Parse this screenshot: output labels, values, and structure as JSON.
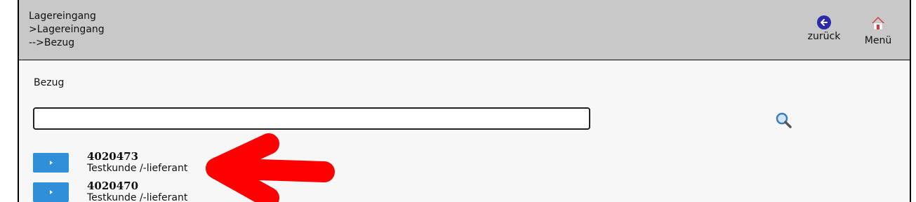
{
  "header": {
    "breadcrumbs": [
      "Lagereingang",
      ">Lagereingang",
      "-->Bezug"
    ],
    "back_label": "zurück",
    "menu_label": "Menü"
  },
  "main": {
    "section_title": "Bezug",
    "search": {
      "value": "",
      "placeholder": ""
    },
    "results": [
      {
        "id": "4020473",
        "name": "Testkunde /-lieferant"
      },
      {
        "id": "4020470",
        "name": "Testkunde /-lieferant"
      }
    ]
  },
  "colors": {
    "header_bg": "#c8c8c8",
    "button_blue": "#2f8fd8",
    "back_icon": "#2a2aaa",
    "annotation_red": "#ff0000"
  }
}
